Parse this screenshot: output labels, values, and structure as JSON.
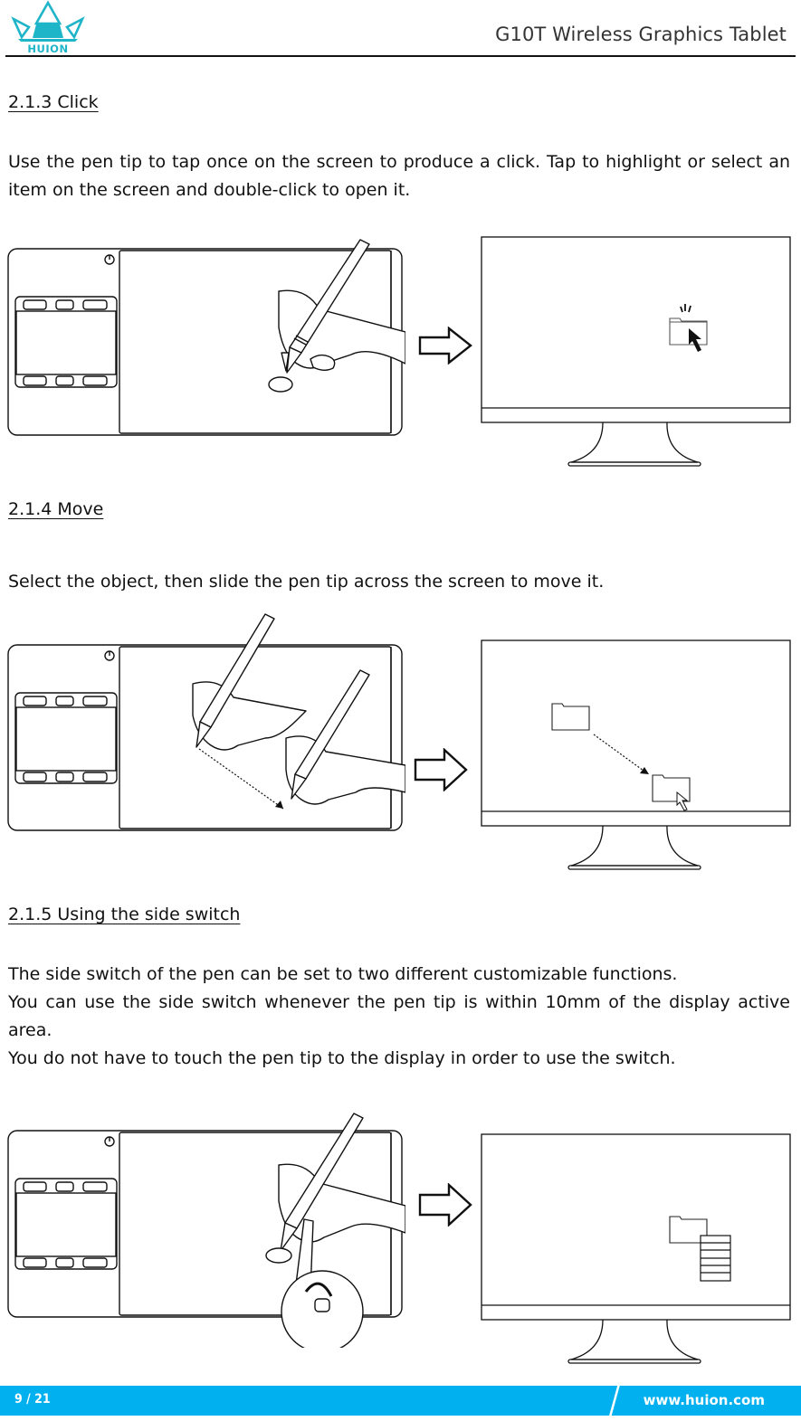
{
  "header": {
    "brand": "HUION",
    "title": "G10T Wireless Graphics Tablet",
    "brand_color": "#1fb5c9"
  },
  "sections": [
    {
      "title": "2.1.3 Click",
      "paragraphs": [
        "Use the pen tip to tap once on the screen to produce a click. Tap to highlight or select an item on the screen and double-click to open it."
      ],
      "figure": {
        "left": "tablet-with-hand-tapping",
        "arrow": "right-arrow",
        "right": "monitor-folder-clicked"
      }
    },
    {
      "title": "2.1.4 Move",
      "paragraphs": [
        "Select the object, then slide the pen tip across the screen to move it."
      ],
      "figure": {
        "left": "tablet-with-hand-dragging",
        "arrow": "right-arrow",
        "right": "monitor-folder-moved"
      }
    },
    {
      "title": "2.1.5 Using the side switch",
      "paragraphs": [
        "The side switch of the pen can be set to two different customizable functions.",
        "You can use the side switch whenever the pen tip is within 10mm of the display active area.",
        "You do not have to touch the pen tip to the display in order to use the switch."
      ],
      "figure": {
        "left": "tablet-with-hand-side-switch",
        "arrow": "right-arrow",
        "right": "monitor-folder-context-menu"
      }
    }
  ],
  "footer": {
    "page": "9 / 21",
    "url": "www.huion.com",
    "color": "#00b0ef"
  }
}
